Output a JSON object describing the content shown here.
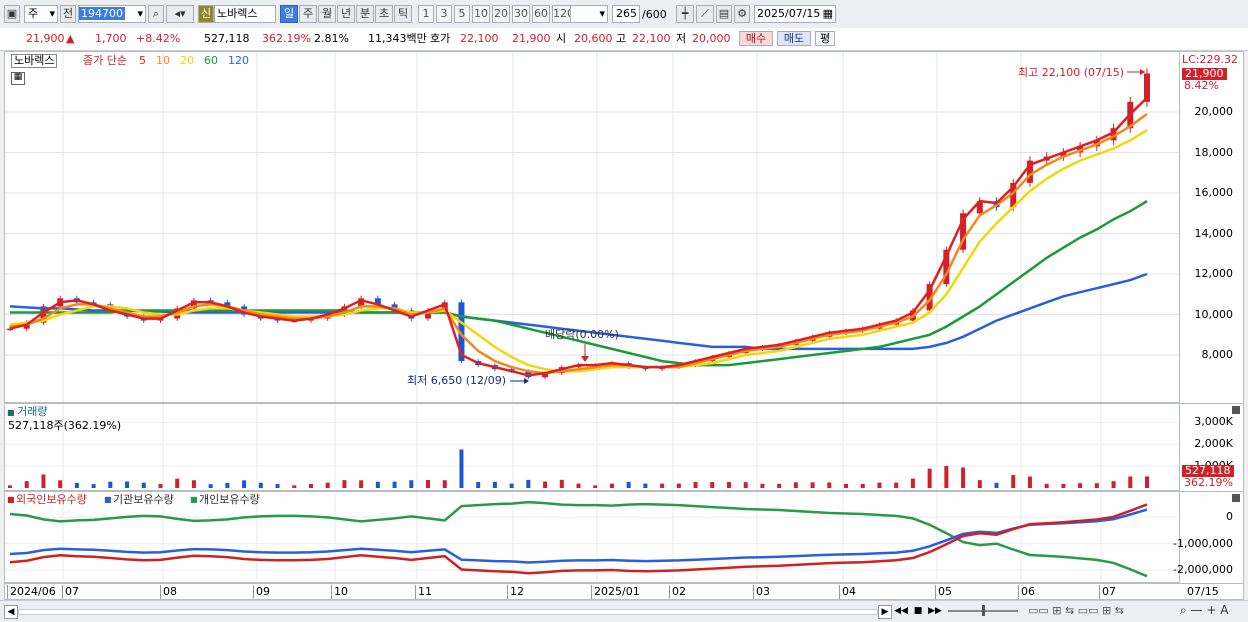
{
  "toolbar": {
    "market": "주",
    "prev": "전",
    "code": "194700",
    "credit_badge": "신",
    "stock_name": "노바렉스",
    "periods": [
      {
        "label": "일",
        "active": true
      },
      {
        "label": "주",
        "active": false
      },
      {
        "label": "월",
        "active": false
      },
      {
        "label": "년",
        "active": false
      },
      {
        "label": "분",
        "active": false
      },
      {
        "label": "초",
        "active": false
      },
      {
        "label": "틱",
        "active": false
      }
    ],
    "intervals": [
      "1",
      "3",
      "5",
      "10",
      "20",
      "30",
      "60",
      "120"
    ],
    "count": "265",
    "count_max": "/600",
    "date": "2025/07/15"
  },
  "quote": {
    "price": "21,900",
    "up_arrow": "▲",
    "change": "1,700",
    "change_pct": "+8.42%",
    "volume": "527,118",
    "volume_pct": "362.19%",
    "turnover": "2.81%",
    "amount": "11,343백만",
    "ask_label": "호가",
    "ask": "22,100",
    "bid": "21,900",
    "open_label": "시",
    "open": "20,600",
    "high_label": "고",
    "high": "22,100",
    "low_label": "저",
    "low": "20,000",
    "buy": "매수",
    "sell": "매도",
    "eval": "평"
  },
  "price_pane": {
    "name_tag": "노바렉스",
    "legend_prefix": "종가 단순",
    "ma_labels": [
      {
        "label": "5",
        "color": "#e02020"
      },
      {
        "label": "10",
        "color": "#f08a1c"
      },
      {
        "label": "20",
        "color": "#f4d60a"
      },
      {
        "label": "60",
        "color": "#1a9a3a"
      },
      {
        "label": "120",
        "color": "#2a5ee0"
      }
    ],
    "lc_label": "LC:229.32",
    "last_price_tag": "21,900",
    "last_pct": "8.42%",
    "y_ticks": [
      "20,000",
      "18,000",
      "16,000",
      "14,000",
      "12,000",
      "10,000",
      "8,000"
    ],
    "high_annot": "최고 22,100 (07/15)",
    "low_annot": "최저 6,650 (12/09)",
    "dividend_annot": "배당락(0.00%)"
  },
  "volume_pane": {
    "title": "거래량",
    "info": "527,118주(362.19%)",
    "y_ticks": [
      "3,000K",
      "2,000K",
      "1,000K"
    ],
    "last_tag": "527,118",
    "last_pct": "362.19%"
  },
  "holdings_pane": {
    "legends": [
      {
        "label": "외국인보유수량",
        "color": "#d02020"
      },
      {
        "label": "기관보유수량",
        "color": "#2a5ee0"
      },
      {
        "label": "개인보유수량",
        "color": "#2a9a4a"
      }
    ],
    "y_ticks": [
      "0",
      "-1,000,000",
      "-2,000,000"
    ]
  },
  "x_axis": {
    "labels": [
      "2024/06",
      "07",
      "08",
      "09",
      "10",
      "11",
      "12",
      "2025/01",
      "02",
      "03",
      "04",
      "05",
      "06",
      "07"
    ],
    "right_label": "07/15"
  },
  "colors": {
    "up": "#d0202a",
    "down": "#1a56d8",
    "ma5": "#e02020",
    "ma10": "#f08a1c",
    "ma20": "#f4d60a",
    "ma60": "#1a9a3a",
    "ma120": "#2a5ee0"
  },
  "chart_data": {
    "type": "line",
    "title": "노바렉스",
    "x_start": "2024/06",
    "x_end": "2025/07/15",
    "y_range": [
      6500,
      22500
    ],
    "close_series": {
      "name": "종가",
      "values": [
        9300,
        9600,
        10400,
        10800,
        10600,
        10500,
        10200,
        9900,
        9700,
        9800,
        10300,
        10700,
        10600,
        10400,
        10000,
        9800,
        9700,
        9700,
        9800,
        10000,
        10400,
        10800,
        10500,
        10200,
        9800,
        10200,
        10600,
        7700,
        7500,
        7300,
        7200,
        6900,
        7100,
        7400,
        7500,
        7500,
        7600,
        7400,
        7300,
        7400,
        7500,
        7700,
        7900,
        8100,
        8300,
        8400,
        8500,
        8700,
        8900,
        9100,
        9200,
        9300,
        9500,
        9700,
        10200,
        11500,
        13200,
        15000,
        15600,
        15300,
        16500,
        17600,
        17800,
        18000,
        18300,
        18600,
        19200,
        20500,
        21900
      ]
    },
    "series": [
      {
        "name": "5",
        "values": [
          9300,
          9500,
          10100,
          10600,
          10700,
          10500,
          10200,
          10000,
          9800,
          9800,
          10200,
          10600,
          10600,
          10400,
          10100,
          9900,
          9800,
          9700,
          9800,
          10000,
          10300,
          10700,
          10500,
          10200,
          9900,
          10200,
          10500,
          8000,
          7600,
          7400,
          7200,
          7000,
          7100,
          7300,
          7500,
          7500,
          7600,
          7500,
          7400,
          7400,
          7500,
          7700,
          7900,
          8100,
          8300,
          8400,
          8500,
          8700,
          8900,
          9100,
          9200,
          9300,
          9500,
          9700,
          10100,
          11200,
          12900,
          14700,
          15600,
          15500,
          16300,
          17400,
          17700,
          18000,
          18300,
          18600,
          19000,
          19900,
          20700
        ]
      },
      {
        "name": "10",
        "values": [
          9400,
          9500,
          9800,
          10300,
          10500,
          10500,
          10300,
          10100,
          9900,
          9900,
          10100,
          10400,
          10500,
          10400,
          10200,
          10000,
          9900,
          9800,
          9800,
          9900,
          10100,
          10400,
          10400,
          10300,
          10000,
          10100,
          10300,
          9000,
          8200,
          7700,
          7400,
          7200,
          7100,
          7200,
          7300,
          7400,
          7500,
          7500,
          7400,
          7400,
          7400,
          7600,
          7800,
          8000,
          8200,
          8300,
          8400,
          8600,
          8800,
          9000,
          9100,
          9200,
          9400,
          9600,
          9900,
          10700,
          12000,
          13700,
          14900,
          15400,
          16000,
          16900,
          17400,
          17800,
          18100,
          18400,
          18800,
          19300,
          19900
        ]
      },
      {
        "name": "20",
        "values": [
          9500,
          9600,
          9700,
          10000,
          10200,
          10400,
          10400,
          10300,
          10100,
          10000,
          10000,
          10200,
          10300,
          10300,
          10200,
          10100,
          10000,
          9900,
          9900,
          9900,
          10000,
          10200,
          10300,
          10300,
          10100,
          10100,
          10200,
          9600,
          9000,
          8400,
          7900,
          7500,
          7300,
          7200,
          7200,
          7300,
          7400,
          7400,
          7400,
          7400,
          7400,
          7500,
          7600,
          7800,
          8000,
          8100,
          8200,
          8400,
          8600,
          8800,
          8900,
          9000,
          9200,
          9400,
          9600,
          10100,
          11000,
          12300,
          13600,
          14500,
          15300,
          16100,
          16700,
          17200,
          17600,
          17900,
          18200,
          18600,
          19100
        ]
      },
      {
        "name": "60",
        "values": [
          10100,
          10100,
          10100,
          10100,
          10100,
          10100,
          10100,
          10200,
          10200,
          10200,
          10200,
          10200,
          10200,
          10200,
          10200,
          10200,
          10200,
          10200,
          10200,
          10200,
          10200,
          10100,
          10100,
          10100,
          10100,
          10100,
          10100,
          9900,
          9800,
          9700,
          9500,
          9300,
          9100,
          8900,
          8700,
          8500,
          8300,
          8100,
          7900,
          7700,
          7600,
          7500,
          7500,
          7500,
          7600,
          7700,
          7800,
          7900,
          8000,
          8100,
          8200,
          8300,
          8400,
          8600,
          8800,
          9000,
          9400,
          9900,
          10400,
          11000,
          11600,
          12200,
          12800,
          13300,
          13800,
          14200,
          14700,
          15100,
          15600
        ]
      },
      {
        "name": "120",
        "values": [
          10400,
          10350,
          10300,
          10300,
          10250,
          10200,
          10200,
          10200,
          10150,
          10150,
          10100,
          10100,
          10100,
          10100,
          10100,
          10100,
          10100,
          10100,
          10100,
          10100,
          10100,
          10100,
          10100,
          10100,
          10100,
          10100,
          10100,
          9900,
          9800,
          9700,
          9600,
          9500,
          9400,
          9300,
          9200,
          9100,
          9000,
          8900,
          8800,
          8700,
          8600,
          8500,
          8400,
          8400,
          8400,
          8300,
          8300,
          8300,
          8300,
          8300,
          8300,
          8300,
          8300,
          8300,
          8300,
          8400,
          8600,
          8900,
          9300,
          9700,
          10000,
          10300,
          10600,
          10900,
          11100,
          11300,
          11500,
          11700,
          12000
        ]
      }
    ],
    "high": {
      "value": 22100,
      "date": "07/15"
    },
    "low": {
      "value": 6650,
      "date": "12/09"
    },
    "volume_ylim": [
      0,
      3200000
    ],
    "holdings_ylim": [
      -2300000,
      800000
    ]
  }
}
